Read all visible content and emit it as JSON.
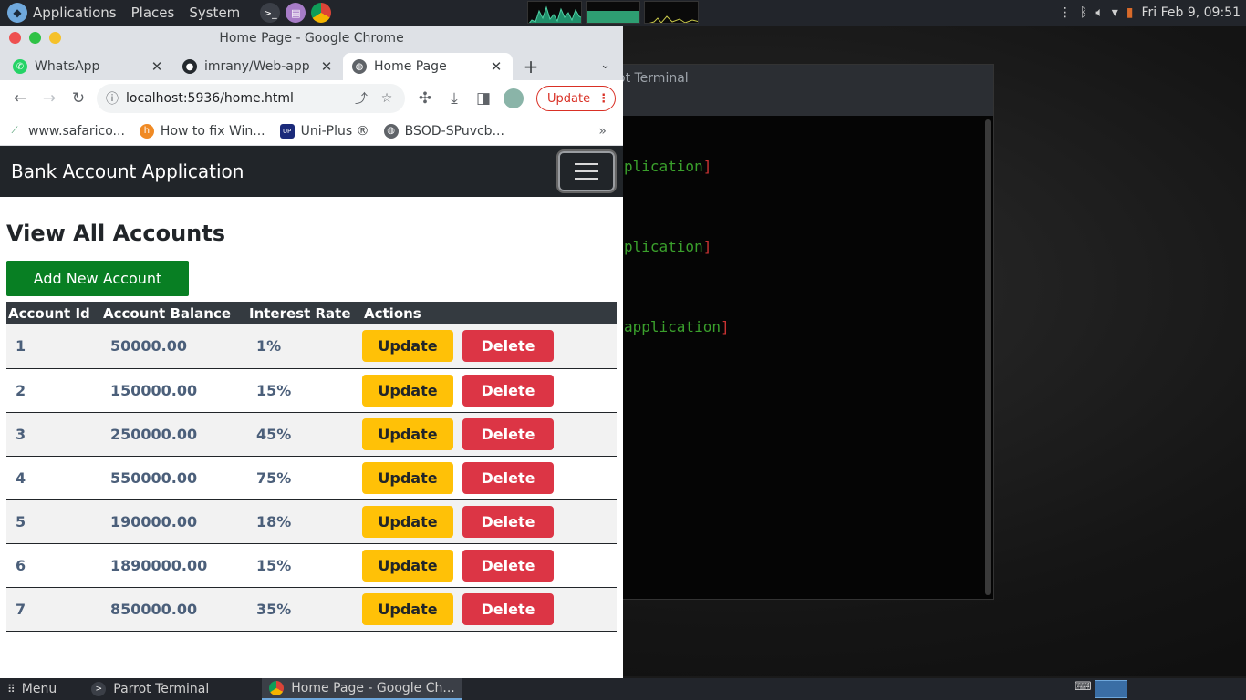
{
  "top_panel": {
    "menus": [
      "Applications",
      "Places",
      "System"
    ],
    "clock": "Fri Feb 9, 09:51"
  },
  "terminal": {
    "title": "ot Terminal",
    "lines": [
      "plication",
      "plication",
      "application"
    ]
  },
  "chrome": {
    "window_title": "Home Page - Google Chrome",
    "tabs": [
      {
        "label": "WhatsApp",
        "icon": "whatsapp-icon"
      },
      {
        "label": "imrany/Web-app",
        "icon": "github-icon"
      },
      {
        "label": "Home Page",
        "icon": "globe-icon"
      }
    ],
    "url": "localhost:5936/home.html",
    "update_label": "Update",
    "bookmarks": [
      {
        "label": "www.safarico...",
        "icon": "safaricom-icon"
      },
      {
        "label": "How to fix Win...",
        "icon": "howto-icon"
      },
      {
        "label": "Uni-Plus ®",
        "icon": "uniplus-icon"
      },
      {
        "label": "BSOD-SPuvcb...",
        "icon": "globe-icon"
      }
    ]
  },
  "app": {
    "brand": "Bank Account Application",
    "heading": "View All Accounts",
    "add_button": "Add New Account",
    "columns": [
      "Account Id",
      "Account Balance",
      "Interest Rate",
      "Actions"
    ],
    "update_label": "Update",
    "delete_label": "Delete",
    "rows": [
      {
        "id": "1",
        "balance": "50000.00",
        "rate": "1%"
      },
      {
        "id": "2",
        "balance": "150000.00",
        "rate": "15%"
      },
      {
        "id": "3",
        "balance": "250000.00",
        "rate": "45%"
      },
      {
        "id": "4",
        "balance": "550000.00",
        "rate": "75%"
      },
      {
        "id": "5",
        "balance": "190000.00",
        "rate": "18%"
      },
      {
        "id": "6",
        "balance": "1890000.00",
        "rate": "15%"
      },
      {
        "id": "7",
        "balance": "850000.00",
        "rate": "35%"
      }
    ]
  },
  "bottom_panel": {
    "menu": "Menu",
    "tasks": [
      {
        "label": "Parrot Terminal",
        "icon": "terminal-icon"
      },
      {
        "label": "Home Page - Google Ch...",
        "icon": "chrome-icon"
      }
    ]
  },
  "colors": {
    "navbar": "#212529",
    "add_button": "#087f23",
    "update_button": "#ffc107",
    "delete_button": "#dc3545",
    "table_header": "#343a40"
  }
}
